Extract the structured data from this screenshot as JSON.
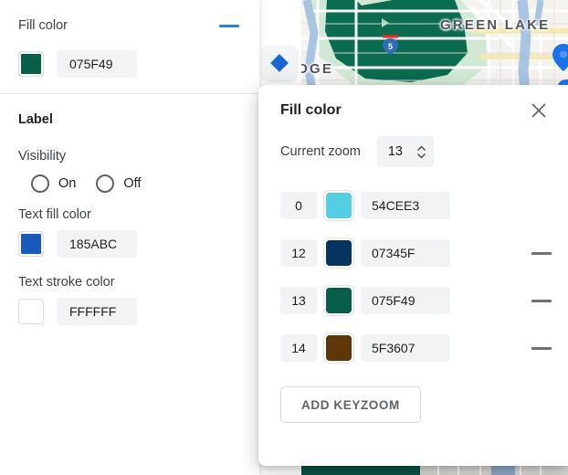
{
  "left_panel": {
    "fill_color_section": {
      "title": "Fill color",
      "collapse_icon": "minus-icon",
      "swatch_hex": "#075F49",
      "value": "075F49"
    },
    "label_section": {
      "title": "Label",
      "visibility_label": "Visibility",
      "radio_on_label": "On",
      "radio_off_label": "Off",
      "text_fill_color_label": "Text fill color",
      "text_fill_swatch_hex": "#185ABC",
      "text_fill_value": "185ABC",
      "text_stroke_color_label": "Text stroke color",
      "text_stroke_swatch_hex": "#FFFFFF",
      "text_stroke_value": "FFFFFF"
    },
    "keyzoom_toggle_icon": "diamond-icon",
    "keyzoom_toggle_color": "#1A66D0"
  },
  "dialog": {
    "title": "Fill color",
    "close_icon": "close-icon",
    "current_zoom_label": "Current zoom",
    "current_zoom_value": "13",
    "stepper_up_icon": "chevron-up-icon",
    "stepper_down_icon": "chevron-down-icon",
    "remove_icon": "minus-icon",
    "keyzooms": [
      {
        "zoom": "0",
        "swatch_hex": "#54CEE3",
        "value": "54CEE3",
        "removable": false
      },
      {
        "zoom": "12",
        "swatch_hex": "#07345F",
        "value": "07345F",
        "removable": true
      },
      {
        "zoom": "13",
        "swatch_hex": "#075F49",
        "value": "075F49",
        "removable": true
      },
      {
        "zoom": "14",
        "swatch_hex": "#5F3607",
        "value": "5F3607",
        "removable": true
      }
    ],
    "add_keyzoom_label": "ADD KEYZOOM"
  },
  "map": {
    "labels": [
      {
        "id": "green-lake",
        "text": "GREEN LAKE"
      },
      {
        "id": "dge",
        "text": "DGE"
      }
    ],
    "highway_shield": "5",
    "park_color": "#0B6B4F",
    "water_color": "#AEC9E3"
  }
}
